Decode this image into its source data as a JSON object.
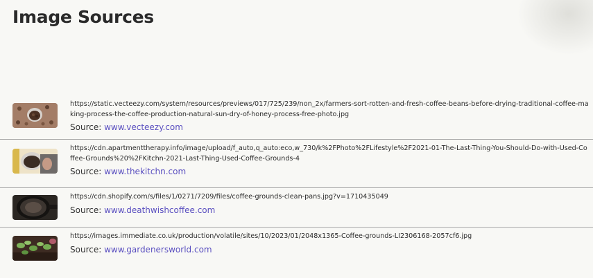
{
  "page": {
    "title": "Image Sources",
    "source_prefix": "Source:"
  },
  "sources": [
    {
      "url": "https://static.vecteezy.com/system/resources/previews/017/725/239/non_2x/farmers-sort-rotten-and-fresh-coffee-beans-before-drying-traditional-coffee-making-process-the-coffee-production-natural-sun-dry-of-honey-process-free-photo.jpg",
      "site": "www.vecteezy.com",
      "thumbnail": "coffee-beans-drying-photo"
    },
    {
      "url": "https://cdn.apartmenttherapy.info/image/upload/f_auto,q_auto:eco,w_730/k%2FPhoto%2FLifestyle%2F2021-01-The-Last-Thing-You-Should-Do-with-Used-Coffee-Grounds%20%2FKitchn-2021-Last-Thing-Used-Coffee-Grounds-4",
      "site": "www.thekitchn.com",
      "thumbnail": "coffee-grounds-in-hand-photo"
    },
    {
      "url": "https://cdn.shopify.com/s/files/1/0271/7209/files/coffee-grounds-clean-pans.jpg?v=1710435049",
      "site": "www.deathwishcoffee.com",
      "thumbnail": "coffee-grounds-pan-photo"
    },
    {
      "url": "https://images.immediate.co.uk/production/volatile/sites/10/2023/01/2048x1365-Coffee-grounds-LI2306168-2057cf6.jpg",
      "site": "www.gardenersworld.com",
      "thumbnail": "coffee-grounds-plants-photo"
    }
  ],
  "colors": {
    "background": "#f8f8f5",
    "link": "#5a4fc0",
    "divider": "#a8a8a8"
  }
}
